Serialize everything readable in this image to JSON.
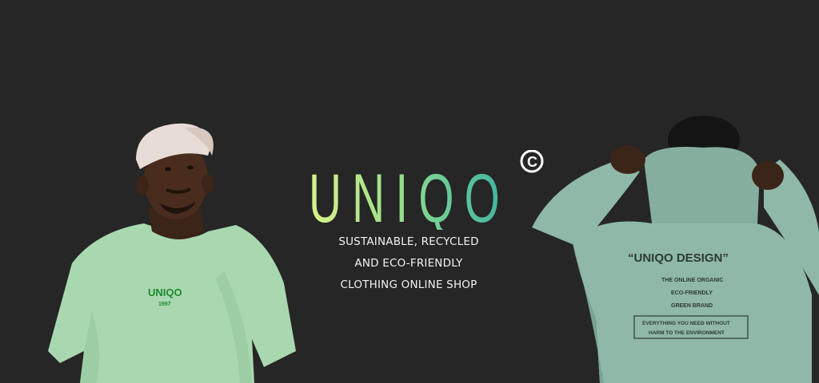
{
  "brand": {
    "name": "UNIQO",
    "mark": "©",
    "gradient": [
      "#d9f28a",
      "#9fe08a",
      "#5dc69a",
      "#3fb2a0"
    ]
  },
  "tagline": {
    "line1": "SUSTAINABLE, RECYCLED",
    "line2": "AND ECO-FRIENDLY",
    "line3": "CLOTHING ONLINE SHOP"
  },
  "tshirt": {
    "logo": "UNIQO",
    "year": "1997",
    "color": "#a9d8b0"
  },
  "hoodie": {
    "title": "“UNIQO DESIGN”",
    "line1": "THE ONLINE ORGANIC",
    "line2": "ECO-FRIENDLY",
    "line3": "GREEN BRAND",
    "box_line1": "EVERYTHING YOU NEED WITHOUT",
    "box_line2": "HARM TO THE ENVIRONMENT",
    "color": "#8fb8a8"
  },
  "background": "#262626"
}
